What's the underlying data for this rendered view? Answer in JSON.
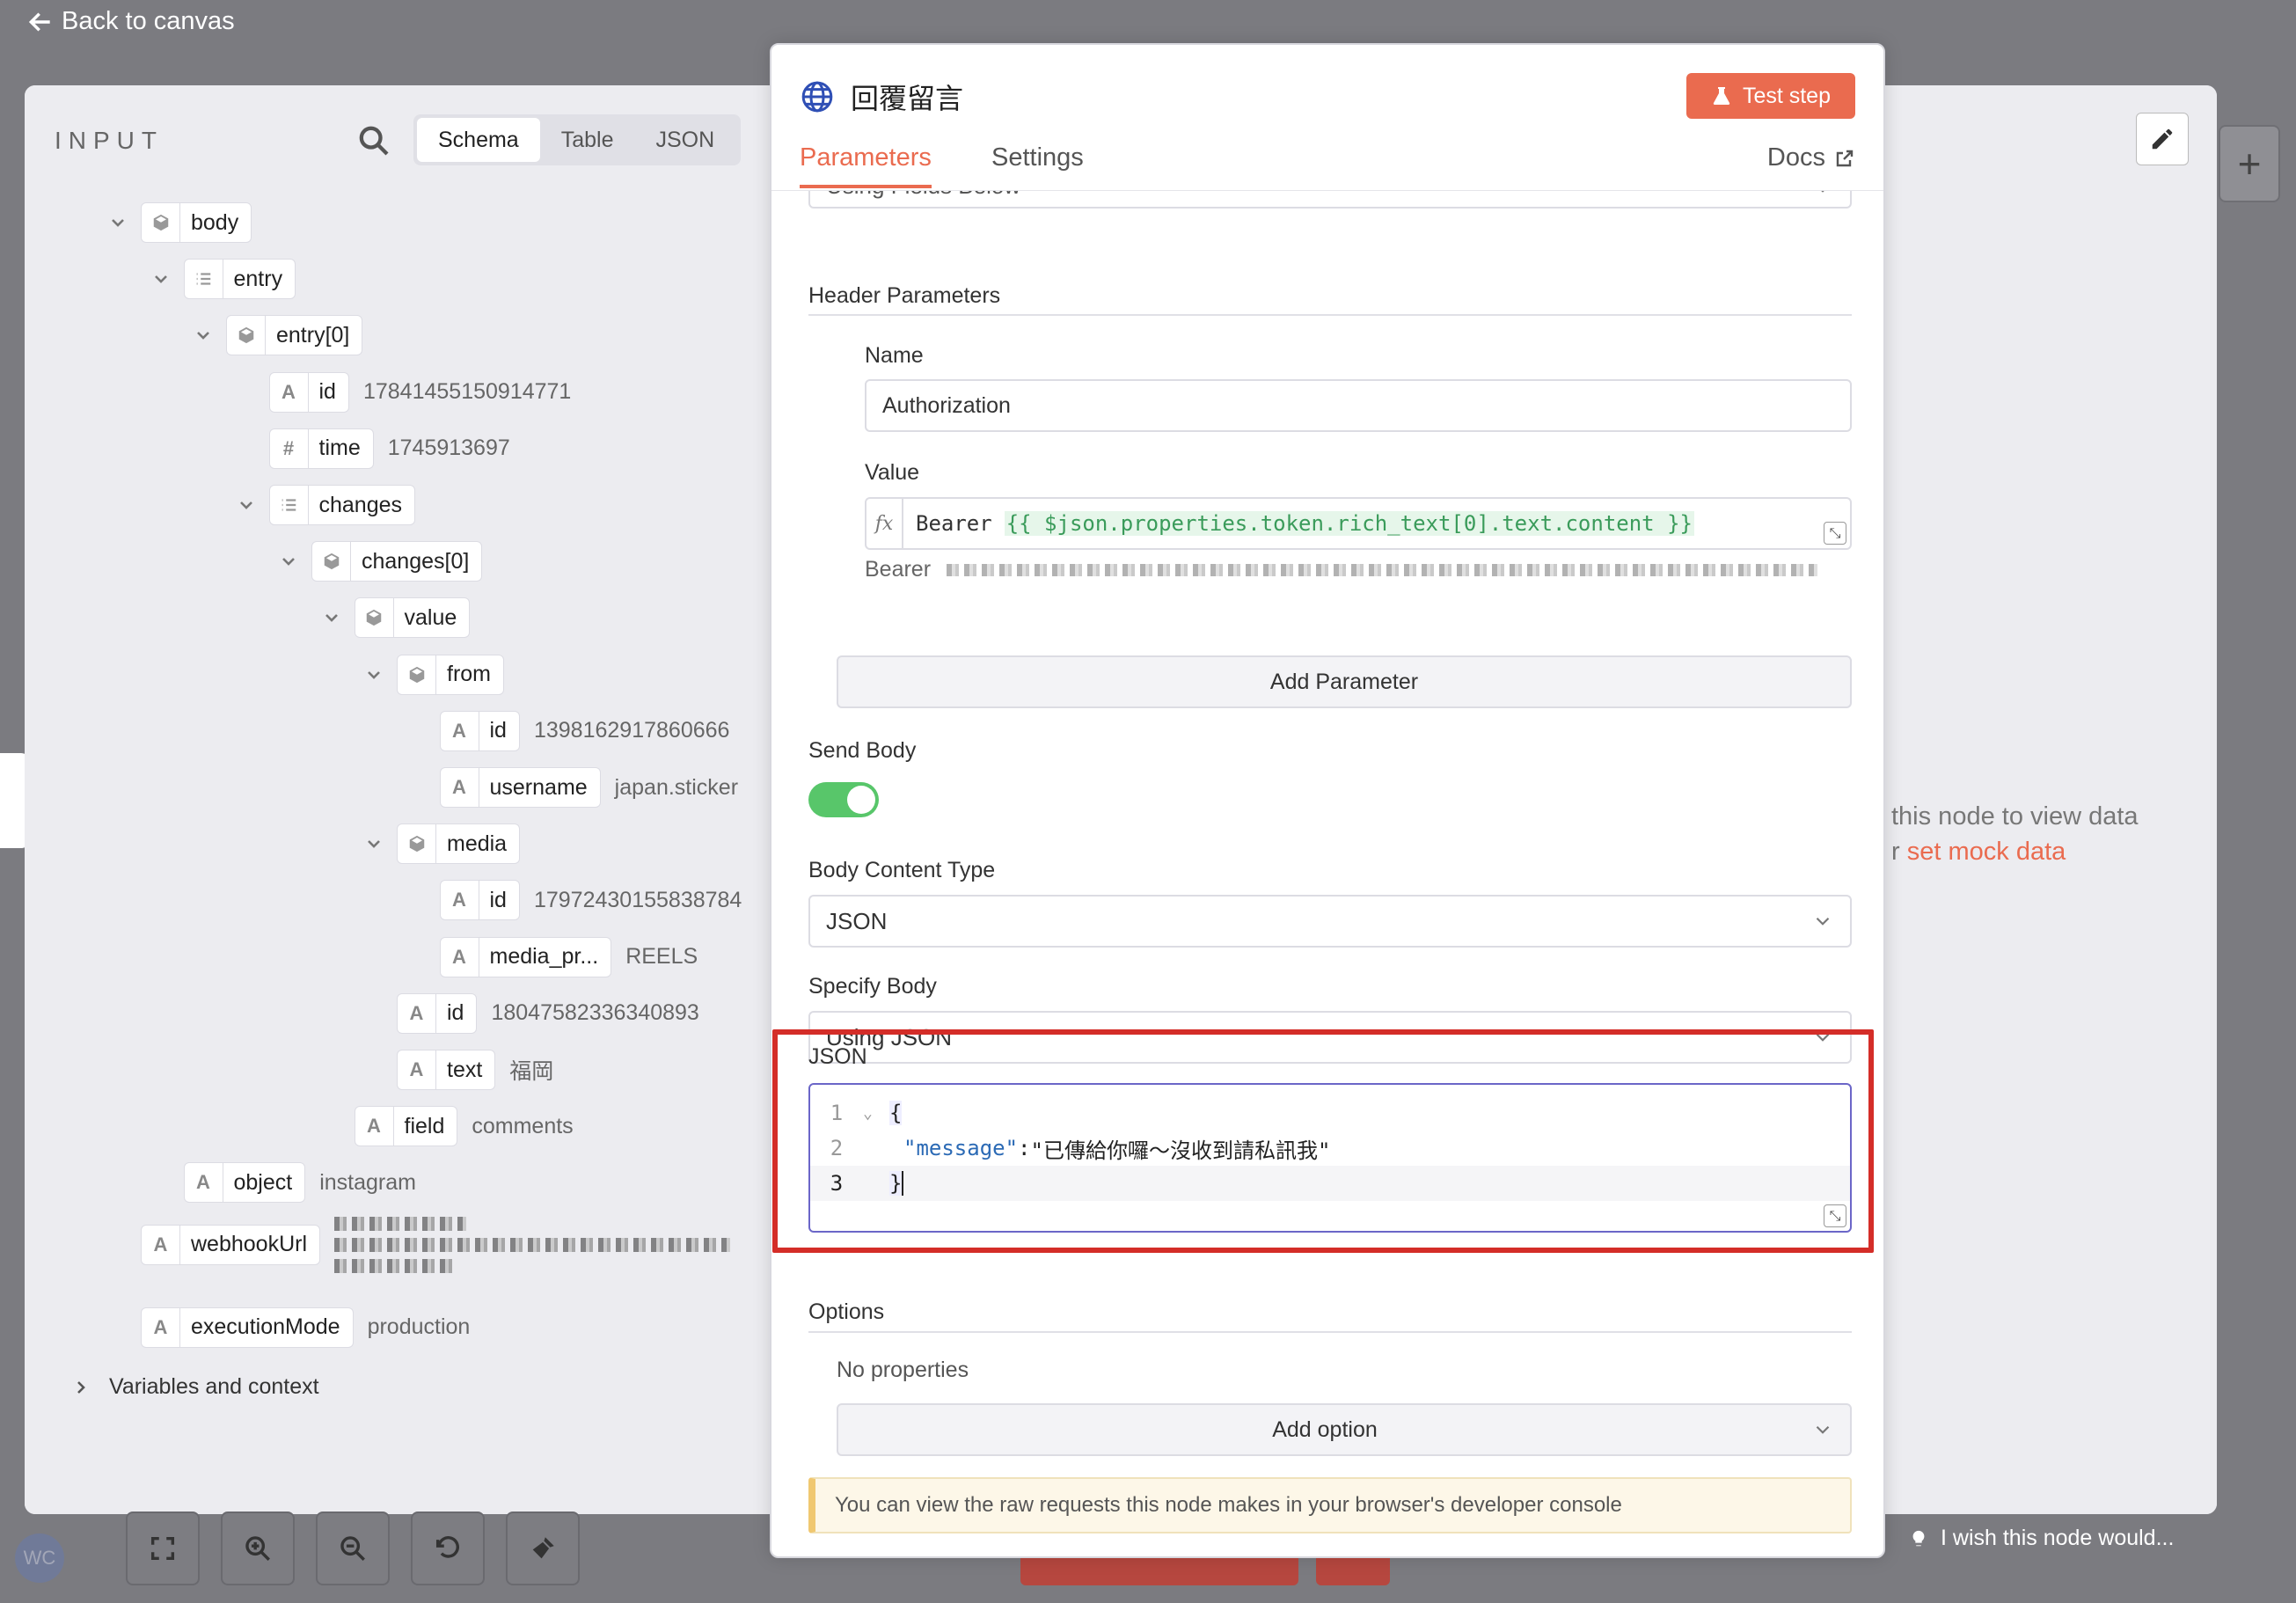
{
  "nav": {
    "back_label": "Back to canvas"
  },
  "input": {
    "title": "INPUT",
    "tabs": [
      "Schema",
      "Table",
      "JSON"
    ],
    "tree": [
      {
        "key": "body",
        "type": "object",
        "value": "",
        "level": 0,
        "chevron": true
      },
      {
        "key": "entry",
        "type": "array",
        "value": "",
        "level": 1,
        "chevron": true
      },
      {
        "key": "entry[0]",
        "type": "object",
        "value": "",
        "level": 2,
        "chevron": true
      },
      {
        "key": "id",
        "type": "string",
        "value": "17841455150914771",
        "level": 3,
        "chevron": false
      },
      {
        "key": "time",
        "type": "number",
        "value": "1745913697",
        "level": 3,
        "chevron": false
      },
      {
        "key": "changes",
        "type": "array",
        "value": "",
        "level": 3,
        "chevron": true
      },
      {
        "key": "changes[0]",
        "type": "object",
        "value": "",
        "level": 4,
        "chevron": true
      },
      {
        "key": "value",
        "type": "object",
        "value": "",
        "level": 5,
        "chevron": true
      },
      {
        "key": "from",
        "type": "object",
        "value": "",
        "level": 6,
        "chevron": true
      },
      {
        "key": "id",
        "type": "string",
        "value": "1398162917860666",
        "level": 7,
        "chevron": false
      },
      {
        "key": "username",
        "type": "string",
        "value": "japan.sticker",
        "level": 7,
        "chevron": false
      },
      {
        "key": "media",
        "type": "object",
        "value": "",
        "level": 6,
        "chevron": true
      },
      {
        "key": "id",
        "type": "string",
        "value": "17972430155838784",
        "level": 7,
        "chevron": false
      },
      {
        "key": "media_pr...",
        "type": "string",
        "value": "REELS",
        "level": 7,
        "chevron": false
      },
      {
        "key": "id",
        "type": "string",
        "value": "18047582336340893",
        "level": 6,
        "chevron": false
      },
      {
        "key": "text",
        "type": "string",
        "value": "福岡",
        "level": 6,
        "chevron": false
      },
      {
        "key": "field",
        "type": "string",
        "value": "comments",
        "level": 5,
        "chevron": false
      },
      {
        "key": "object",
        "type": "string",
        "value": "instagram",
        "level": 1,
        "chevron": false
      },
      {
        "key": "webhookUrl",
        "type": "string",
        "value": "",
        "level": 0,
        "chevron": false,
        "blurred": true
      },
      {
        "key": "executionMode",
        "type": "string",
        "value": "production",
        "level": 0,
        "chevron": false
      }
    ],
    "variables_label": "Variables and context"
  },
  "node": {
    "title": "回覆留言",
    "test_step_label": "Test step",
    "tabs": {
      "parameters": "Parameters",
      "settings": "Settings",
      "docs": "Docs"
    },
    "partial_select_value": "Using Fields Below",
    "header_params_label": "Header Parameters",
    "name_label": "Name",
    "name_value": "Authorization",
    "value_label": "Value",
    "value_prefix": "Bearer",
    "value_expression": "{{ $json.properties.token.rich_text[0].text.content }}",
    "value_preview_prefix": "Bearer",
    "add_parameter_label": "Add Parameter",
    "send_body_label": "Send Body",
    "send_body_enabled": true,
    "body_content_type_label": "Body Content Type",
    "body_content_type_value": "JSON",
    "specify_body_label": "Specify Body",
    "specify_body_value": "Using JSON",
    "json_label": "JSON",
    "json_lines": [
      {
        "num": "1",
        "fold": "⌄",
        "open": "{"
      },
      {
        "num": "2",
        "key": "\"message\"",
        "colon": ":",
        "value": "\"已傳給你囉～沒收到請私訊我\""
      },
      {
        "num": "3",
        "close": "}"
      }
    ],
    "options_label": "Options",
    "no_properties": "No properties",
    "add_option_label": "Add option",
    "info_banner": "You can view the raw requests this node makes in your browser's developer console"
  },
  "output": {
    "hint_line1": "this node to view data",
    "hint_line2_prefix": "r",
    "mock_link": "set mock data",
    "wish_label": "I wish this node would..."
  },
  "avatar_initials": "WC",
  "colors": {
    "accent": "#ea6b4f",
    "toggle_on": "#58c66a",
    "highlight": "#d42d28",
    "editor_border": "#6b66c8"
  }
}
